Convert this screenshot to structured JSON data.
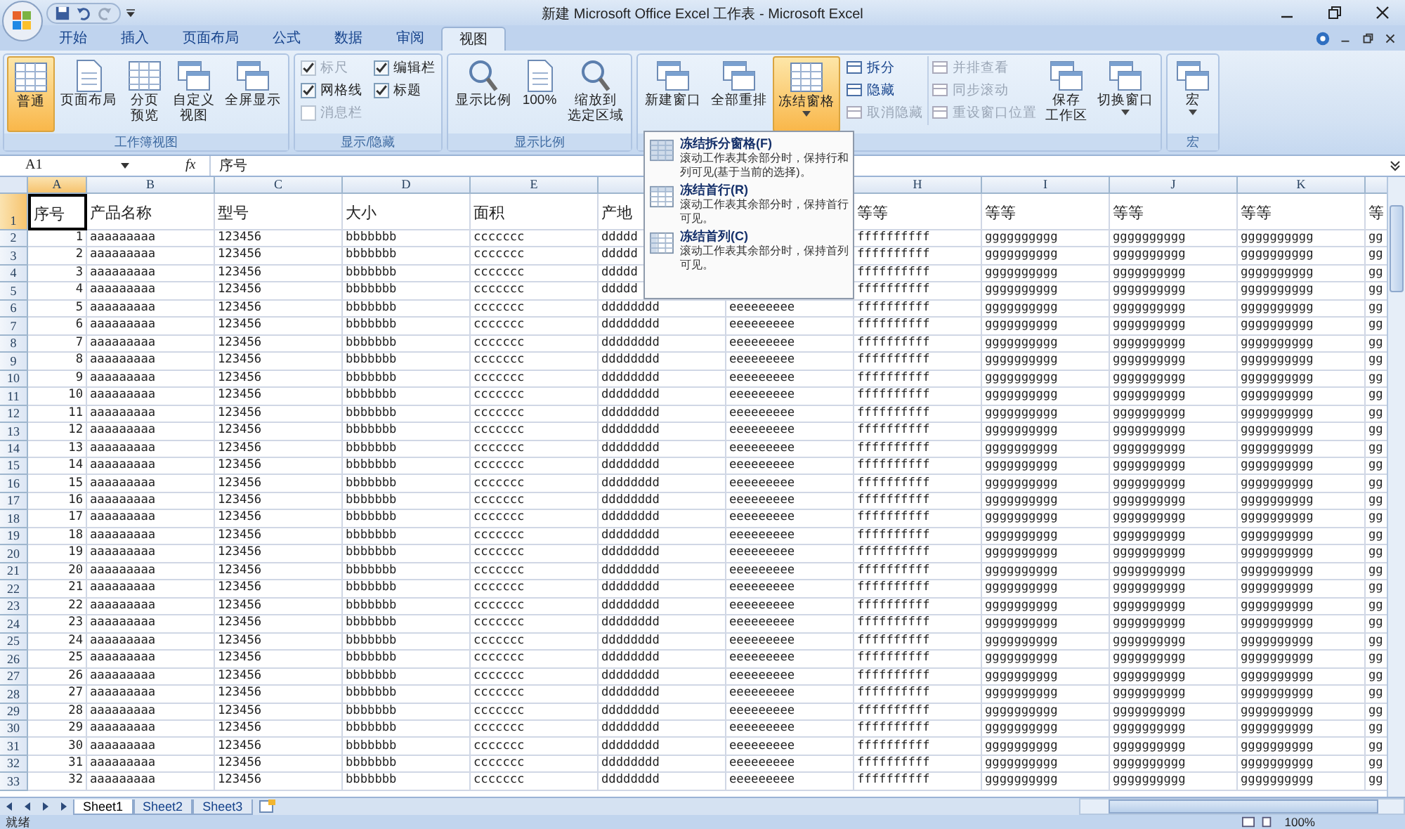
{
  "window": {
    "title": "新建 Microsoft Office Excel 工作表 - Microsoft Excel"
  },
  "tabs": [
    {
      "label": "开始",
      "selected": false
    },
    {
      "label": "插入",
      "selected": false
    },
    {
      "label": "页面布局",
      "selected": false
    },
    {
      "label": "公式",
      "selected": false
    },
    {
      "label": "数据",
      "selected": false
    },
    {
      "label": "审阅",
      "selected": false
    },
    {
      "label": "视图",
      "selected": true
    }
  ],
  "ribbon": {
    "groups": [
      {
        "label": "工作簿视图",
        "items": [
          {
            "kind": "large",
            "label": "普通",
            "selected": true,
            "menu": false
          },
          {
            "kind": "large",
            "label": "页面布局",
            "selected": false,
            "menu": false
          },
          {
            "kind": "large",
            "lines": [
              "分页",
              "预览"
            ],
            "selected": false,
            "menu": false
          },
          {
            "kind": "large",
            "lines": [
              "自定义",
              "视图"
            ],
            "selected": false,
            "menu": false
          },
          {
            "kind": "large",
            "label": "全屏显示",
            "selected": false,
            "menu": false
          }
        ]
      },
      {
        "label": "显示/隐藏",
        "items": [
          {
            "kind": "checks",
            "items": [
              {
                "label": "标尺",
                "checked": true,
                "disabled": true
              },
              {
                "label": "编辑栏",
                "checked": true,
                "disabled": false
              },
              {
                "label": "网格线",
                "checked": true,
                "disabled": false
              },
              {
                "label": "标题",
                "checked": true,
                "disabled": false
              },
              {
                "label": "消息栏",
                "checked": false,
                "disabled": true
              }
            ]
          }
        ]
      },
      {
        "label": "显示比例",
        "items": [
          {
            "kind": "large",
            "label": "显示比例",
            "selected": false,
            "menu": false
          },
          {
            "kind": "large",
            "label": "100%",
            "selected": false,
            "menu": false
          },
          {
            "kind": "large",
            "lines": [
              "缩放到",
              "选定区域"
            ],
            "selected": false,
            "menu": false
          }
        ]
      },
      {
        "items": [
          {
            "kind": "large",
            "label": "新建窗口",
            "selected": false,
            "menu": false
          },
          {
            "kind": "large",
            "label": "全部重排",
            "selected": false,
            "menu": false
          },
          {
            "kind": "large",
            "label": "冻结窗格",
            "selected": true,
            "menu": true
          },
          {
            "kind": "stack",
            "items": [
              {
                "label": "拆分",
                "disabled": false
              },
              {
                "label": "隐藏",
                "disabled": false
              },
              {
                "label": "取消隐藏",
                "disabled": true
              }
            ]
          },
          {
            "kind": "stack",
            "items": [
              {
                "label": "并排查看",
                "disabled": true
              },
              {
                "label": "同步滚动",
                "disabled": true
              },
              {
                "label": "重设窗口位置",
                "disabled": true
              }
            ]
          },
          {
            "kind": "large",
            "lines": [
              "保存",
              "工作区"
            ],
            "selected": false,
            "menu": false
          },
          {
            "kind": "large",
            "label": "切换窗口",
            "selected": false,
            "menu": true
          }
        ]
      },
      {
        "label": "宏",
        "items": [
          {
            "kind": "large",
            "label": "宏",
            "selected": false,
            "menu": true
          }
        ]
      }
    ]
  },
  "formula_bar": {
    "name_box": "A1",
    "function_label": "fx",
    "content": "序号"
  },
  "dropdown": {
    "items": [
      {
        "title": "冻结拆分窗格(F)",
        "description": "滚动工作表其余部分时，保持行和列可见(基于当前的选择)。"
      },
      {
        "title": "冻结首行(R)",
        "description": "滚动工作表其余部分时，保持首行可见。"
      },
      {
        "title": "冻结首列(C)",
        "description": "滚动工作表其余部分时，保持首列可见。"
      }
    ]
  },
  "grid": {
    "columns": [
      {
        "label": "A",
        "selected": true
      },
      {
        "label": "B",
        "selected": false
      },
      {
        "label": "C",
        "selected": false
      },
      {
        "label": "D",
        "selected": false
      },
      {
        "label": "E",
        "selected": false
      },
      null,
      null,
      {
        "label": "H",
        "selected": false
      },
      {
        "label": "I",
        "selected": false
      },
      {
        "label": "J",
        "selected": false
      },
      {
        "label": "K",
        "selected": false
      }
    ],
    "rows": [
      {
        "number": "1",
        "selected": true,
        "cells": [
          "序号",
          "产品名称",
          "型号",
          "大小",
          "面积",
          "产地",
          null,
          "等等",
          "等等",
          "等等",
          "等等",
          "等"
        ]
      },
      {
        "number": "2",
        "selected": false,
        "cells": [
          "1",
          "aaaaaaaaa",
          "123456",
          "bbbbbbb",
          "ccccccc",
          "ddddd",
          null,
          "ffffffffff",
          "gggggggggg",
          "gggggggggg",
          "gggggggggg",
          "gg"
        ]
      },
      {
        "number": "3",
        "selected": false,
        "cells": [
          "2",
          "aaaaaaaaa",
          "123456",
          "bbbbbbb",
          "ccccccc",
          "ddddd",
          null,
          "ffffffffff",
          "gggggggggg",
          "gggggggggg",
          "gggggggggg",
          "gg"
        ]
      },
      {
        "number": "4",
        "selected": false,
        "cells": [
          "3",
          "aaaaaaaaa",
          "123456",
          "bbbbbbb",
          "ccccccc",
          "ddddd",
          null,
          "ffffffffff",
          "gggggggggg",
          "gggggggggg",
          "gggggggggg",
          "gg"
        ]
      },
      {
        "number": "5",
        "selected": false,
        "cells": [
          "4",
          "aaaaaaaaa",
          "123456",
          "bbbbbbb",
          "ccccccc",
          "ddddd",
          null,
          "ffffffffff",
          "gggggggggg",
          "gggggggggg",
          "gggggggggg",
          "gg"
        ]
      },
      {
        "number": "6",
        "selected": false,
        "cells": [
          "5",
          "aaaaaaaaa",
          "123456",
          "bbbbbbb",
          "ccccccc",
          "dddddddd",
          "eeeeeeeee",
          "ffffffffff",
          "gggggggggg",
          "gggggggggg",
          "gggggggggg",
          "gg"
        ]
      },
      {
        "number": "7",
        "selected": false,
        "cells": [
          "6",
          "aaaaaaaaa",
          "123456",
          "bbbbbbb",
          "ccccccc",
          "dddddddd",
          "eeeeeeeee",
          "ffffffffff",
          "gggggggggg",
          "gggggggggg",
          "gggggggggg",
          "gg"
        ]
      },
      {
        "number": "8",
        "selected": false,
        "cells": [
          "7",
          "aaaaaaaaa",
          "123456",
          "bbbbbbb",
          "ccccccc",
          "dddddddd",
          "eeeeeeeee",
          "ffffffffff",
          "gggggggggg",
          "gggggggggg",
          "gggggggggg",
          "gg"
        ]
      },
      {
        "number": "9",
        "selected": false,
        "cells": [
          "8",
          "aaaaaaaaa",
          "123456",
          "bbbbbbb",
          "ccccccc",
          "dddddddd",
          "eeeeeeeee",
          "ffffffffff",
          "gggggggggg",
          "gggggggggg",
          "gggggggggg",
          "gg"
        ]
      },
      {
        "number": "10",
        "selected": false,
        "cells": [
          "9",
          "aaaaaaaaa",
          "123456",
          "bbbbbbb",
          "ccccccc",
          "dddddddd",
          "eeeeeeeee",
          "ffffffffff",
          "gggggggggg",
          "gggggggggg",
          "gggggggggg",
          "gg"
        ]
      },
      {
        "number": "11",
        "selected": false,
        "cells": [
          "10",
          "aaaaaaaaa",
          "123456",
          "bbbbbbb",
          "ccccccc",
          "dddddddd",
          "eeeeeeeee",
          "ffffffffff",
          "gggggggggg",
          "gggggggggg",
          "gggggggggg",
          "gg"
        ]
      },
      {
        "number": "12",
        "selected": false,
        "cells": [
          "11",
          "aaaaaaaaa",
          "123456",
          "bbbbbbb",
          "ccccccc",
          "dddddddd",
          "eeeeeeeee",
          "ffffffffff",
          "gggggggggg",
          "gggggggggg",
          "gggggggggg",
          "gg"
        ]
      },
      {
        "number": "13",
        "selected": false,
        "cells": [
          "12",
          "aaaaaaaaa",
          "123456",
          "bbbbbbb",
          "ccccccc",
          "dddddddd",
          "eeeeeeeee",
          "ffffffffff",
          "gggggggggg",
          "gggggggggg",
          "gggggggggg",
          "gg"
        ]
      },
      {
        "number": "14",
        "selected": false,
        "cells": [
          "13",
          "aaaaaaaaa",
          "123456",
          "bbbbbbb",
          "ccccccc",
          "dddddddd",
          "eeeeeeeee",
          "ffffffffff",
          "gggggggggg",
          "gggggggggg",
          "gggggggggg",
          "gg"
        ]
      },
      {
        "number": "15",
        "selected": false,
        "cells": [
          "14",
          "aaaaaaaaa",
          "123456",
          "bbbbbbb",
          "ccccccc",
          "dddddddd",
          "eeeeeeeee",
          "ffffffffff",
          "gggggggggg",
          "gggggggggg",
          "gggggggggg",
          "gg"
        ]
      },
      {
        "number": "16",
        "selected": false,
        "cells": [
          "15",
          "aaaaaaaaa",
          "123456",
          "bbbbbbb",
          "ccccccc",
          "dddddddd",
          "eeeeeeeee",
          "ffffffffff",
          "gggggggggg",
          "gggggggggg",
          "gggggggggg",
          "gg"
        ]
      },
      {
        "number": "17",
        "selected": false,
        "cells": [
          "16",
          "aaaaaaaaa",
          "123456",
          "bbbbbbb",
          "ccccccc",
          "dddddddd",
          "eeeeeeeee",
          "ffffffffff",
          "gggggggggg",
          "gggggggggg",
          "gggggggggg",
          "gg"
        ]
      },
      {
        "number": "18",
        "selected": false,
        "cells": [
          "17",
          "aaaaaaaaa",
          "123456",
          "bbbbbbb",
          "ccccccc",
          "dddddddd",
          "eeeeeeeee",
          "ffffffffff",
          "gggggggggg",
          "gggggggggg",
          "gggggggggg",
          "gg"
        ]
      },
      {
        "number": "19",
        "selected": false,
        "cells": [
          "18",
          "aaaaaaaaa",
          "123456",
          "bbbbbbb",
          "ccccccc",
          "dddddddd",
          "eeeeeeeee",
          "ffffffffff",
          "gggggggggg",
          "gggggggggg",
          "gggggggggg",
          "gg"
        ]
      },
      {
        "number": "20",
        "selected": false,
        "cells": [
          "19",
          "aaaaaaaaa",
          "123456",
          "bbbbbbb",
          "ccccccc",
          "dddddddd",
          "eeeeeeeee",
          "ffffffffff",
          "gggggggggg",
          "gggggggggg",
          "gggggggggg",
          "gg"
        ]
      },
      {
        "number": "21",
        "selected": false,
        "cells": [
          "20",
          "aaaaaaaaa",
          "123456",
          "bbbbbbb",
          "ccccccc",
          "dddddddd",
          "eeeeeeeee",
          "ffffffffff",
          "gggggggggg",
          "gggggggggg",
          "gggggggggg",
          "gg"
        ]
      },
      {
        "number": "22",
        "selected": false,
        "cells": [
          "21",
          "aaaaaaaaa",
          "123456",
          "bbbbbbb",
          "ccccccc",
          "dddddddd",
          "eeeeeeeee",
          "ffffffffff",
          "gggggggggg",
          "gggggggggg",
          "gggggggggg",
          "gg"
        ]
      },
      {
        "number": "23",
        "selected": false,
        "cells": [
          "22",
          "aaaaaaaaa",
          "123456",
          "bbbbbbb",
          "ccccccc",
          "dddddddd",
          "eeeeeeeee",
          "ffffffffff",
          "gggggggggg",
          "gggggggggg",
          "gggggggggg",
          "gg"
        ]
      },
      {
        "number": "24",
        "selected": false,
        "cells": [
          "23",
          "aaaaaaaaa",
          "123456",
          "bbbbbbb",
          "ccccccc",
          "dddddddd",
          "eeeeeeeee",
          "ffffffffff",
          "gggggggggg",
          "gggggggggg",
          "gggggggggg",
          "gg"
        ]
      },
      {
        "number": "25",
        "selected": false,
        "cells": [
          "24",
          "aaaaaaaaa",
          "123456",
          "bbbbbbb",
          "ccccccc",
          "dddddddd",
          "eeeeeeeee",
          "ffffffffff",
          "gggggggggg",
          "gggggggggg",
          "gggggggggg",
          "gg"
        ]
      },
      {
        "number": "26",
        "selected": false,
        "cells": [
          "25",
          "aaaaaaaaa",
          "123456",
          "bbbbbbb",
          "ccccccc",
          "dddddddd",
          "eeeeeeeee",
          "ffffffffff",
          "gggggggggg",
          "gggggggggg",
          "gggggggggg",
          "gg"
        ]
      },
      {
        "number": "27",
        "selected": false,
        "cells": [
          "26",
          "aaaaaaaaa",
          "123456",
          "bbbbbbb",
          "ccccccc",
          "dddddddd",
          "eeeeeeeee",
          "ffffffffff",
          "gggggggggg",
          "gggggggggg",
          "gggggggggg",
          "gg"
        ]
      },
      {
        "number": "28",
        "selected": false,
        "cells": [
          "27",
          "aaaaaaaaa",
          "123456",
          "bbbbbbb",
          "ccccccc",
          "dddddddd",
          "eeeeeeeee",
          "ffffffffff",
          "gggggggggg",
          "gggggggggg",
          "gggggggggg",
          "gg"
        ]
      },
      {
        "number": "29",
        "selected": false,
        "cells": [
          "28",
          "aaaaaaaaa",
          "123456",
          "bbbbbbb",
          "ccccccc",
          "dddddddd",
          "eeeeeeeee",
          "ffffffffff",
          "gggggggggg",
          "gggggggggg",
          "gggggggggg",
          "gg"
        ]
      },
      {
        "number": "30",
        "selected": false,
        "cells": [
          "29",
          "aaaaaaaaa",
          "123456",
          "bbbbbbb",
          "ccccccc",
          "dddddddd",
          "eeeeeeeee",
          "ffffffffff",
          "gggggggggg",
          "gggggggggg",
          "gggggggggg",
          "gg"
        ]
      },
      {
        "number": "31",
        "selected": false,
        "cells": [
          "30",
          "aaaaaaaaa",
          "123456",
          "bbbbbbb",
          "ccccccc",
          "dddddddd",
          "eeeeeeeee",
          "ffffffffff",
          "gggggggggg",
          "gggggggggg",
          "gggggggggg",
          "gg"
        ]
      },
      {
        "number": "32",
        "selected": false,
        "cells": [
          "31",
          "aaaaaaaaa",
          "123456",
          "bbbbbbb",
          "ccccccc",
          "dddddddd",
          "eeeeeeeee",
          "ffffffffff",
          "gggggggggg",
          "gggggggggg",
          "gggggggggg",
          "gg"
        ]
      },
      {
        "number": "33",
        "selected": false,
        "cells": [
          "32",
          "aaaaaaaaa",
          "123456",
          "bbbbbbb",
          "ccccccc",
          "dddddddd",
          "eeeeeeeee",
          "ffffffffff",
          "gggggggggg",
          "gggggggggg",
          "gggggggggg",
          "gg"
        ]
      }
    ]
  },
  "sheet_tabs": [
    {
      "label": "Sheet1",
      "selected": true
    },
    {
      "label": "Sheet2",
      "selected": false
    },
    {
      "label": "Sheet3",
      "selected": false
    }
  ],
  "status_bar": {
    "text": "就绪",
    "zoom": "100%"
  }
}
